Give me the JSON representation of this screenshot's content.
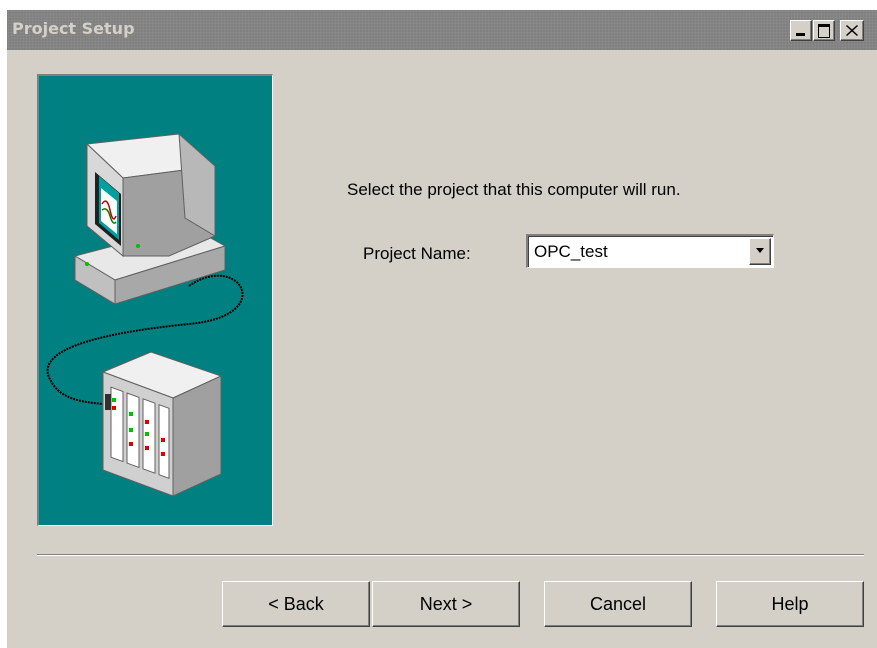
{
  "window": {
    "title": "Project Setup",
    "controls": {
      "minimize_icon": "minimize-icon",
      "maximize_icon": "maximize-icon",
      "close_icon": "close-icon"
    }
  },
  "illustration": {
    "description_icon": "computer-to-plc-illustration",
    "background_color": "#008080"
  },
  "main": {
    "instruction": "Select the project that this computer will run.",
    "project_name_label": "Project Name:",
    "project_name_value": "OPC_test"
  },
  "buttons": {
    "back": "< Back",
    "next": "Next >",
    "cancel": "Cancel",
    "help": "Help"
  },
  "colors": {
    "dialog_face": "#d4d0c8",
    "titlebar_inactive": "#808080",
    "accent_teal": "#008080"
  }
}
